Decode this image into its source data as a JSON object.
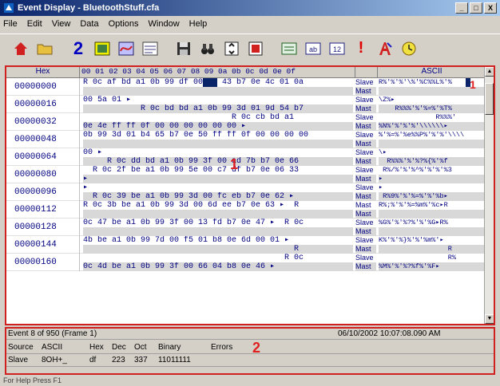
{
  "window": {
    "title": "Event Display - BluetoothStuff.cfa",
    "min": "_",
    "max": "□",
    "close": "X"
  },
  "menu": [
    "File",
    "Edit",
    "View",
    "Data",
    "Options",
    "Window",
    "Help"
  ],
  "toolbar": {
    "two_label": "2",
    "ab_label": "ab",
    "twelve_label": "12",
    "bang_label": "!"
  },
  "headers": {
    "hex": "Hex",
    "columns": "00 01 02 03 04 05 06 07 08 09 0a 0b 0c 0d 0e 0f",
    "ascii": "ASCII"
  },
  "rows": [
    {
      "addr": "00000000",
      "hex1": "R 0c af bd a1 0b 99 df 00 86 43 b7 0e 4c 01 0a",
      "hex2": "",
      "dir1": "Slave",
      "dir2": "Mast",
      "asc1": "R%'%'%'\\%'%C%%L%'%",
      "asc2": ""
    },
    {
      "addr": "00000016",
      "hex1": "00 5a 01 ▸",
      "hex2": "            R 0c bd bd a1 0b 99 3d 01 9d 54 b7",
      "dir1": "Slave",
      "dir2": "Mast",
      "asc1": "\\Z%▸",
      "asc2": "    R%%%'%'%=%'%T%"
    },
    {
      "addr": "00000032",
      "hex1": "                               R 0c cb bd a1",
      "hex2": "0e 4e ff ff 0f 00 00 00 00 00 00 ▸",
      "dir1": "Slave",
      "dir2": "Mast",
      "asc1": "              R%%%'",
      "asc2": "%N%'%'%'%'\\\\\\\\\\\\▸"
    },
    {
      "addr": "00000048",
      "hex1": "0b 99 3d 01 b4 65 b7 0e 50 ff ff 0f 00 00 00 00",
      "hex2": "",
      "dir1": "Slave",
      "dir2": "Mast",
      "asc1": "%'%=%'%e%%P%'%'%'\\\\\\\\",
      "asc2": ""
    },
    {
      "addr": "00000064",
      "hex1": "00 ▸",
      "hex2": "     R 0c dd bd a1 0b 99 3f 00 ad 7b b7 0e 66",
      "dir1": "Slave",
      "dir2": "Mast",
      "asc1": "\\▸",
      "asc2": "  R%%%'%'%?%{%'%f"
    },
    {
      "addr": "00000080",
      "hex1": "  R 0c 2f be a1 0b 99 5e 00 c7 df b7 0e 06 33",
      "hex2": "▸",
      "dir1": "Slave",
      "dir2": "Mast",
      "asc1": " R%/%'%'%^%'%'%'%3",
      "asc2": "▸"
    },
    {
      "addr": "00000096",
      "hex1": "▸",
      "hex2": "  R 0c 39 be a1 0b 99 3d 00 fc eb b7 0e 62 ▸",
      "dir1": "Slave",
      "dir2": "Mast",
      "asc1": "▸",
      "asc2": " R%9%'%'%=%'%'%b▸"
    },
    {
      "addr": "00000112",
      "hex1": "R 0c 3b be a1 0b 99 3d 00 6d ee b7 0e 63 ▸  R",
      "hex2": "",
      "dir1": "Mast",
      "dir2": "Mast",
      "asc1": "R%;%'%'%=%m%'%c▸R",
      "asc2": ""
    },
    {
      "addr": "00000128",
      "hex1": "0c 47 be a1 0b 99 3f 00 13 fd b7 0e 47 ▸  R 0c",
      "hex2": "",
      "dir1": "Slave",
      "dir2": "Mast",
      "asc1": "%G%'%'%?%'%'%G▸R%",
      "asc2": ""
    },
    {
      "addr": "00000144",
      "hex1": "4b be a1 0b 99 7d 00 f5 01 b8 0e 6d 00 01 ▸",
      "hex2": "                                            R",
      "dir1": "Slave",
      "dir2": "Mast",
      "asc1": "K%'%'%}%'%'%m%'▸",
      "asc2": "                 R"
    },
    {
      "addr": "00000160",
      "hex1": "                                          R 0c",
      "hex2": "0c 4d be a1 0b 99 3f 00 66 04 b8 0e 46 ▸",
      "dir1": "Slave",
      "dir2": "Mast",
      "asc1": "                 R%",
      "asc2": "%M%'%'%?%f%'%F▸"
    }
  ],
  "callouts": {
    "one_a": "1",
    "one_b": "1",
    "two": "2"
  },
  "status": {
    "event": "Event 8 of 950 (Frame 1)",
    "timestamp": "06/10/2002 10:07:08.090 AM",
    "headers": [
      "Source",
      "ASCII",
      "Hex",
      "Dec",
      "Oct",
      "Binary",
      "Errors"
    ],
    "values": [
      "Slave",
      "8OH+_",
      "df",
      "223",
      "337",
      "11011111",
      ""
    ]
  },
  "footer": "For Help Press F1"
}
